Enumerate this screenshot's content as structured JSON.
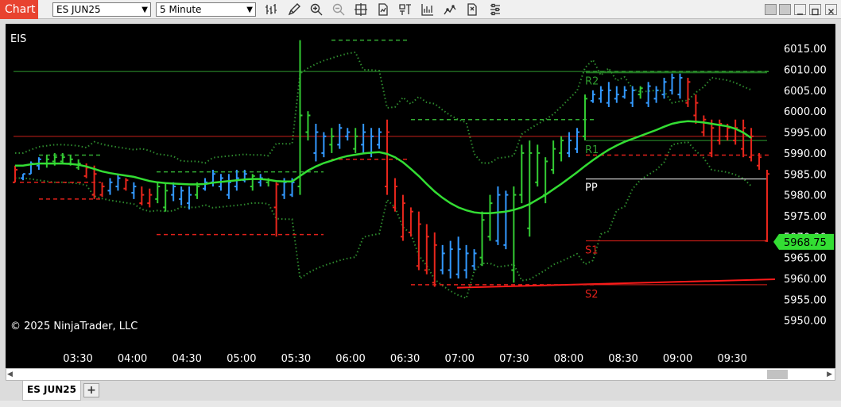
{
  "window": {
    "title": "Chart",
    "instrument": "ES JUN25",
    "interval": "5 Minute",
    "tab_label": "ES JUN25",
    "add_tab_label": "+"
  },
  "toolbar": {
    "icons": [
      "bar-type-icon",
      "drawing-tool-icon",
      "zoom-in-icon",
      "zoom-out-icon",
      "crosshair-icon",
      "data-series-icon",
      "indicators-icon",
      "strategies-icon",
      "chart-trader-icon",
      "templates-icon",
      "properties-icon"
    ]
  },
  "chart": {
    "instrument_label": "EIS",
    "copyright": "© 2025 NinjaTrader, LLC",
    "last_price": "5968.75",
    "colors": {
      "background": "#000000",
      "up_bar": "#3399ff",
      "down_bar": "#e8261c",
      "neutral_bar": "#33cc33",
      "ma_line": "#33dd33",
      "band": "#2e8b2e",
      "resistance": "#33aa33",
      "support": "#e82020",
      "pivot": "#ffffff",
      "price_badge": "#33dd33"
    }
  },
  "chart_data": {
    "type": "ohlc",
    "y_ticks": [
      6015,
      6010,
      6005,
      6000,
      5995,
      5990,
      5985,
      5980,
      5975,
      5970,
      5965,
      5960,
      5955,
      5950
    ],
    "y_tick_labels": [
      "6015.00",
      "6010.00",
      "6005.00",
      "6000.00",
      "5995.00",
      "5990.00",
      "5985.00",
      "5980.00",
      "5975.00",
      "5970.00",
      "5965.00",
      "5960.00",
      "5955.00",
      "5950.00"
    ],
    "ylim": [
      5947.5,
      6023
    ],
    "x_ticks": [
      "03:30",
      "04:00",
      "04:30",
      "05:00",
      "05:30",
      "06:00",
      "06:30",
      "07:00",
      "07:30",
      "08:00",
      "08:30",
      "09:00",
      "09:30"
    ],
    "pivots": [
      {
        "name": "R2",
        "value": 6009.2,
        "kind": "resistance"
      },
      {
        "name": "R1",
        "value": 5993,
        "kind": "resistance"
      },
      {
        "name": "PP",
        "value": 5983.8,
        "kind": "pivot"
      },
      {
        "name": "S1",
        "value": 5969,
        "kind": "support"
      },
      {
        "name": "S2",
        "value": 5958.5,
        "kind": "support"
      }
    ],
    "horizontal_lines": [
      {
        "value": 6009.5,
        "kind": "resistance"
      },
      {
        "value": 5994,
        "kind": "support"
      }
    ],
    "bars": [
      [
        5987,
        5983,
        5983,
        5986,
        "d"
      ],
      [
        5985,
        5983.5,
        5984,
        5985,
        "u"
      ],
      [
        5988,
        5985,
        5985,
        5987.5,
        "u"
      ],
      [
        5989,
        5986,
        5987,
        5988.5,
        "u"
      ],
      [
        5989.5,
        5986.5,
        5987.5,
        5988.5,
        "n"
      ],
      [
        5990,
        5987,
        5988,
        5989,
        "n"
      ],
      [
        5990,
        5987.5,
        5988,
        5989,
        "n"
      ],
      [
        5989.5,
        5987,
        5987.5,
        5988.5,
        "n"
      ],
      [
        5988.5,
        5986,
        5986.5,
        5987.5,
        "n"
      ],
      [
        5987.5,
        5984,
        5984.5,
        5986.5,
        "d"
      ],
      [
        5987,
        5979,
        5980,
        5985,
        "d"
      ],
      [
        5983,
        5979.5,
        5980,
        5982,
        "d"
      ],
      [
        5984,
        5980,
        5981,
        5983,
        "u"
      ],
      [
        5985,
        5981,
        5982,
        5984,
        "u"
      ],
      [
        5984,
        5981,
        5981.5,
        5983.5,
        "d"
      ],
      [
        5983,
        5979,
        5980.5,
        5982,
        "u"
      ],
      [
        5982,
        5977.5,
        5978,
        5980,
        "d"
      ],
      [
        5981.5,
        5977,
        5978,
        5980,
        "d"
      ],
      [
        5983,
        5978,
        5979,
        5982,
        "n"
      ],
      [
        5983,
        5976,
        5977,
        5981,
        "n"
      ],
      [
        5983,
        5978.5,
        5980,
        5982,
        "u"
      ],
      [
        5982,
        5977.5,
        5979,
        5981,
        "u"
      ],
      [
        5982,
        5976.5,
        5978,
        5980,
        "u"
      ],
      [
        5983,
        5979,
        5980,
        5982,
        "n"
      ],
      [
        5984,
        5981,
        5981.5,
        5983,
        "u"
      ],
      [
        5986,
        5982,
        5983,
        5985,
        "u"
      ],
      [
        5985,
        5981,
        5982,
        5984,
        "u"
      ],
      [
        5985,
        5979,
        5980,
        5983,
        "u"
      ],
      [
        5986,
        5981,
        5982,
        5984,
        "u"
      ],
      [
        5986,
        5983,
        5983.5,
        5985,
        "u"
      ],
      [
        5985,
        5981,
        5982,
        5984.5,
        "n"
      ],
      [
        5985,
        5982,
        5983,
        5984,
        "u"
      ],
      [
        5984,
        5982,
        5983,
        5983.5,
        "n"
      ],
      [
        5983,
        5970,
        5977,
        5982.5,
        "d"
      ],
      [
        5984,
        5979,
        5980,
        5983,
        "u"
      ],
      [
        5984,
        5979.5,
        5980,
        5983,
        "u"
      ],
      [
        6017,
        5980,
        5982,
        5999,
        "n"
      ],
      [
        6000,
        5993,
        5995,
        5999,
        "n"
      ],
      [
        5997,
        5988,
        5990,
        5995,
        "u"
      ],
      [
        5995,
        5989,
        5990,
        5994,
        "u"
      ],
      [
        5996,
        5990,
        5992,
        5994,
        "n"
      ],
      [
        5997,
        5991,
        5992,
        5996,
        "u"
      ],
      [
        5996,
        5993,
        5994,
        5995,
        "u"
      ],
      [
        5996,
        5990,
        5991,
        5994,
        "n"
      ],
      [
        5997,
        5990,
        5992,
        5995,
        "u"
      ],
      [
        5996,
        5989,
        5990,
        5994,
        "u"
      ],
      [
        5996,
        5991,
        5992,
        5995,
        "u"
      ],
      [
        5998,
        5980,
        5982,
        5995,
        "d"
      ],
      [
        5984,
        5976,
        5977,
        5982,
        "d"
      ],
      [
        5980,
        5969,
        5970,
        5978,
        "d"
      ],
      [
        5977,
        5970,
        5971,
        5976,
        "d"
      ],
      [
        5976,
        5962,
        5963,
        5973,
        "d"
      ],
      [
        5973,
        5961,
        5962,
        5970,
        "d"
      ],
      [
        5971,
        5958,
        5959,
        5968,
        "d"
      ],
      [
        5968,
        5961,
        5962,
        5966,
        "u"
      ],
      [
        5969,
        5960,
        5962,
        5967,
        "u"
      ],
      [
        5970,
        5960,
        5961,
        5967,
        "u"
      ],
      [
        5968,
        5960,
        5962,
        5966,
        "u"
      ],
      [
        5967,
        5962,
        5963,
        5966,
        "u"
      ],
      [
        5976,
        5963,
        5965,
        5974,
        "n"
      ],
      [
        5980,
        5969,
        5970,
        5978,
        "n"
      ],
      [
        5982,
        5968,
        5969,
        5980,
        "u"
      ],
      [
        5981,
        5967,
        5968,
        5980,
        "u"
      ],
      [
        5982,
        5959,
        5962,
        5980,
        "n"
      ],
      [
        5992,
        5978,
        5980,
        5990,
        "n"
      ],
      [
        5993,
        5970,
        5972,
        5990,
        "n"
      ],
      [
        5992,
        5982,
        5983,
        5990,
        "n"
      ],
      [
        5989,
        5978,
        5980,
        5988,
        "n"
      ],
      [
        5993,
        5985,
        5986,
        5991,
        "n"
      ],
      [
        5994,
        5988,
        5990,
        5993,
        "n"
      ],
      [
        5995,
        5989,
        5990,
        5993,
        "u"
      ],
      [
        5996,
        5990,
        5991,
        5995,
        "u"
      ],
      [
        6004,
        5993,
        5994,
        6003,
        "n"
      ],
      [
        6005,
        6002,
        6002.5,
        6004,
        "u"
      ],
      [
        6006,
        6002,
        6003,
        6005,
        "u"
      ],
      [
        6007,
        6001,
        6002,
        6005,
        "u"
      ],
      [
        6006,
        6002,
        6003,
        6004,
        "u"
      ],
      [
        6006,
        6003,
        6003.5,
        6005,
        "u"
      ],
      [
        6006,
        6001,
        6002,
        6005,
        "u"
      ],
      [
        6006,
        6003,
        6004,
        6005.5,
        "n"
      ],
      [
        6007,
        6001,
        6002,
        6006,
        "u"
      ],
      [
        6006,
        6002,
        6003,
        6005,
        "u"
      ],
      [
        6008,
        6003,
        6004,
        6007,
        "u"
      ],
      [
        6009,
        6004,
        6005,
        6008,
        "u"
      ],
      [
        6009,
        6003,
        6004,
        6008,
        "u"
      ],
      [
        6008,
        6001,
        6002,
        6007,
        "d"
      ],
      [
        6004,
        5997,
        5999,
        6002,
        "d"
      ],
      [
        5999,
        5994,
        5995,
        5998,
        "d"
      ],
      [
        5998,
        5989,
        5990,
        5996,
        "d"
      ],
      [
        5998,
        5992,
        5993,
        5997,
        "d"
      ],
      [
        5997,
        5993,
        5994,
        5996,
        "d"
      ],
      [
        5998,
        5992,
        5993,
        5996,
        "d"
      ],
      [
        5998,
        5989,
        5991,
        5996,
        "d"
      ],
      [
        5996,
        5988,
        5989,
        5994,
        "d"
      ],
      [
        5990,
        5986,
        5987,
        5989,
        "d"
      ],
      [
        5986,
        5968.75,
        5969,
        5985,
        "d"
      ]
    ],
    "moving_average": [
      5987,
      5987,
      5987.3,
      5987.5,
      5987.5,
      5987.5,
      5987.5,
      5987.4,
      5987.2,
      5986.8,
      5986.2,
      5985.6,
      5985.2,
      5984.9,
      5984.6,
      5984.3,
      5983.8,
      5983.3,
      5983,
      5982.8,
      5982.7,
      5982.6,
      5982.5,
      5982.5,
      5982.6,
      5982.9,
      5983.1,
      5983.3,
      5983.5,
      5983.7,
      5983.8,
      5983.8,
      5983.6,
      5983.3,
      5983.2,
      5983.2,
      5984.5,
      5985.8,
      5986.8,
      5987.6,
      5988.2,
      5988.8,
      5989.3,
      5989.6,
      5989.9,
      5990.1,
      5990.2,
      5989.8,
      5989,
      5987.8,
      5986.2,
      5984.5,
      5982.6,
      5980.8,
      5979.3,
      5978,
      5977,
      5976.3,
      5975.8,
      5975.6,
      5975.6,
      5975.8,
      5976,
      5976.4,
      5977,
      5977.8,
      5978.9,
      5980,
      5981.3,
      5982.6,
      5984,
      5985.4,
      5986.9,
      5988.3,
      5989.6,
      5990.8,
      5991.8,
      5992.7,
      5993.4,
      5994.1,
      5994.8,
      5995.5,
      5996.3,
      5997,
      5997.4,
      5997.6,
      5997.5,
      5997.3,
      5997,
      5996.7,
      5996.4,
      5995.8,
      5994.9,
      5993.6
    ]
  }
}
